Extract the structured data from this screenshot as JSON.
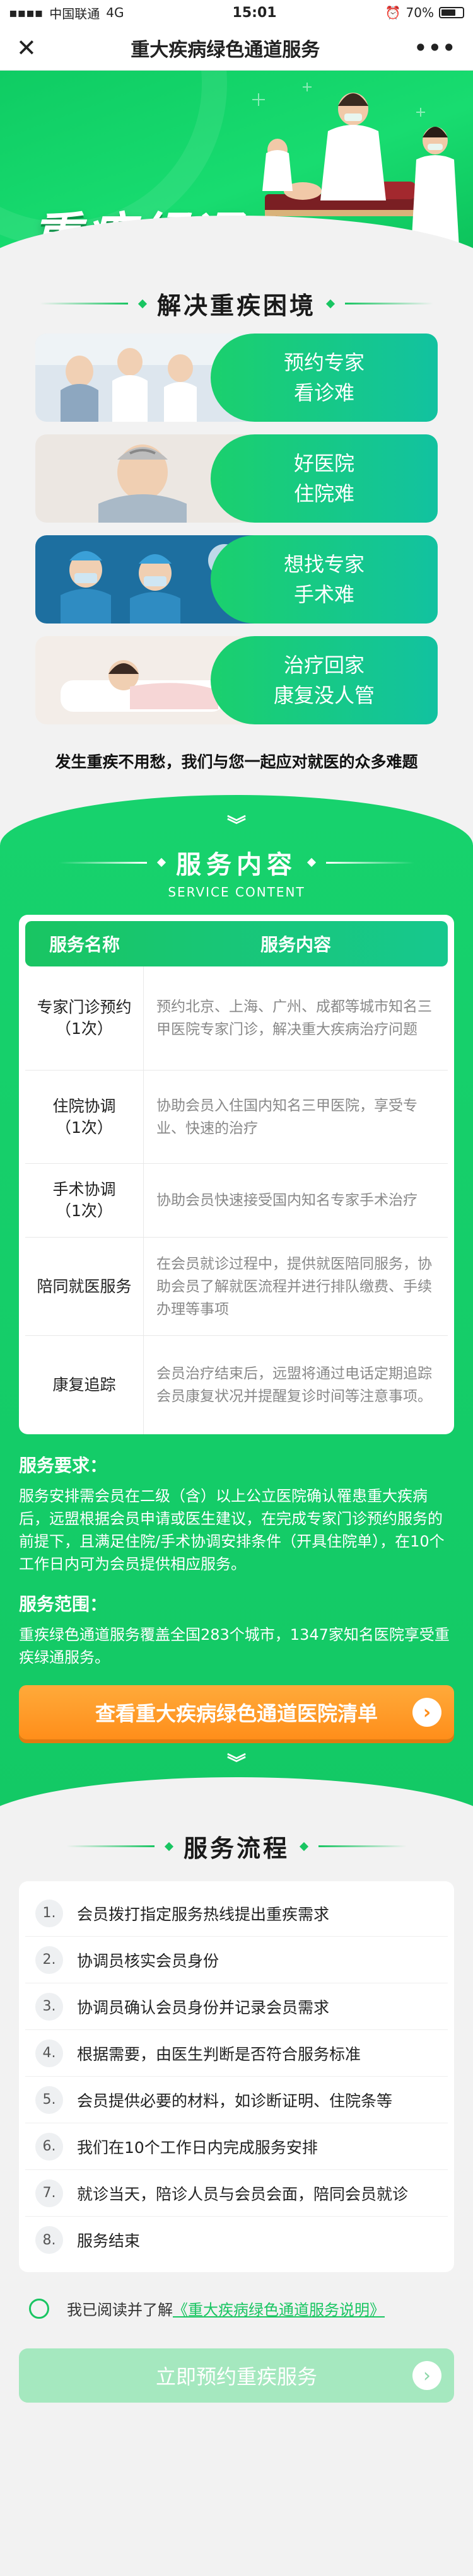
{
  "status": {
    "carrier": "中国联通",
    "network": "4G",
    "time": "15:01",
    "battery": "70%"
  },
  "nav": {
    "title": "重大疾病绿色通道服务"
  },
  "hero": {
    "title": "重疾绿通"
  },
  "problems": {
    "heading": "解决重疾困境",
    "items": [
      {
        "line1": "预约专家",
        "line2": "看诊难"
      },
      {
        "line1": "好医院",
        "line2": "住院难"
      },
      {
        "line1": "想找专家",
        "line2": "手术难"
      },
      {
        "line1": "治疗回家",
        "line2": "康复没人管"
      }
    ],
    "tagline": "发生重疾不用愁，我们与您一起应对就医的众多难题"
  },
  "service": {
    "heading": "服务内容",
    "subheading": "SERVICE CONTENT",
    "col_name": "服务名称",
    "col_content": "服务内容",
    "rows": [
      {
        "name": "专家门诊预约\n（1次）",
        "content": "预约北京、上海、广州、成都等城市知名三甲医院专家门诊，解决重大疾病治疗问题"
      },
      {
        "name": "住院协调\n（1次）",
        "content": "协助会员入住国内知名三甲医院，享受专业、快速的治疗"
      },
      {
        "name": "手术协调\n（1次）",
        "content": "协助会员快速接受国内知名专家手术治疗"
      },
      {
        "name": "陪同就医服务",
        "content": "在会员就诊过程中，提供就医陪同服务，协助会员了解就医流程并进行排队缴费、手续办理等事项"
      },
      {
        "name": "康复追踪",
        "content": "会员治疗结束后，远盟将通过电话定期追踪会员康复状况并提醒复诊时间等注意事项。"
      }
    ],
    "req_title": "服务要求：",
    "req_text": "服务安排需会员在二级（含）以上公立医院确认罹患重大疾病后，远盟根据会员申请或医生建议，在完成专家门诊预约服务的前提下，且满足住院/手术协调安排条件（开具住院单），在10个工作日内可为会员提供相应服务。",
    "scope_title": "服务范围：",
    "scope_text": "重疾绿色通道服务覆盖全国283个城市，1347家知名医院享受重疾绿通服务。",
    "cta": "查看重大疾病绿色通道医院清单"
  },
  "process": {
    "heading": "服务流程",
    "steps": [
      {
        "num": "1.",
        "label": "会员拨打指定服务热线提出重疾需求"
      },
      {
        "num": "2.",
        "label": "协调员核实会员身份"
      },
      {
        "num": "3.",
        "label": "协调员确认会员身份并记录会员需求"
      },
      {
        "num": "4.",
        "label": "根据需要，由医生判断是否符合服务标准"
      },
      {
        "num": "5.",
        "label": "会员提供必要的材料，如诊断证明、住院条等"
      },
      {
        "num": "6.",
        "label": "我们在10个工作日内完成服务安排"
      },
      {
        "num": "7.",
        "label": "就诊当天，陪诊人员与会员会面，陪同会员就诊"
      },
      {
        "num": "8.",
        "label": "服务结束"
      }
    ]
  },
  "agree": {
    "prefix": "我已阅读并了解",
    "link": "《重大疾病绿色通道服务说明》"
  },
  "book": {
    "label": "立即预约重疾服务"
  }
}
